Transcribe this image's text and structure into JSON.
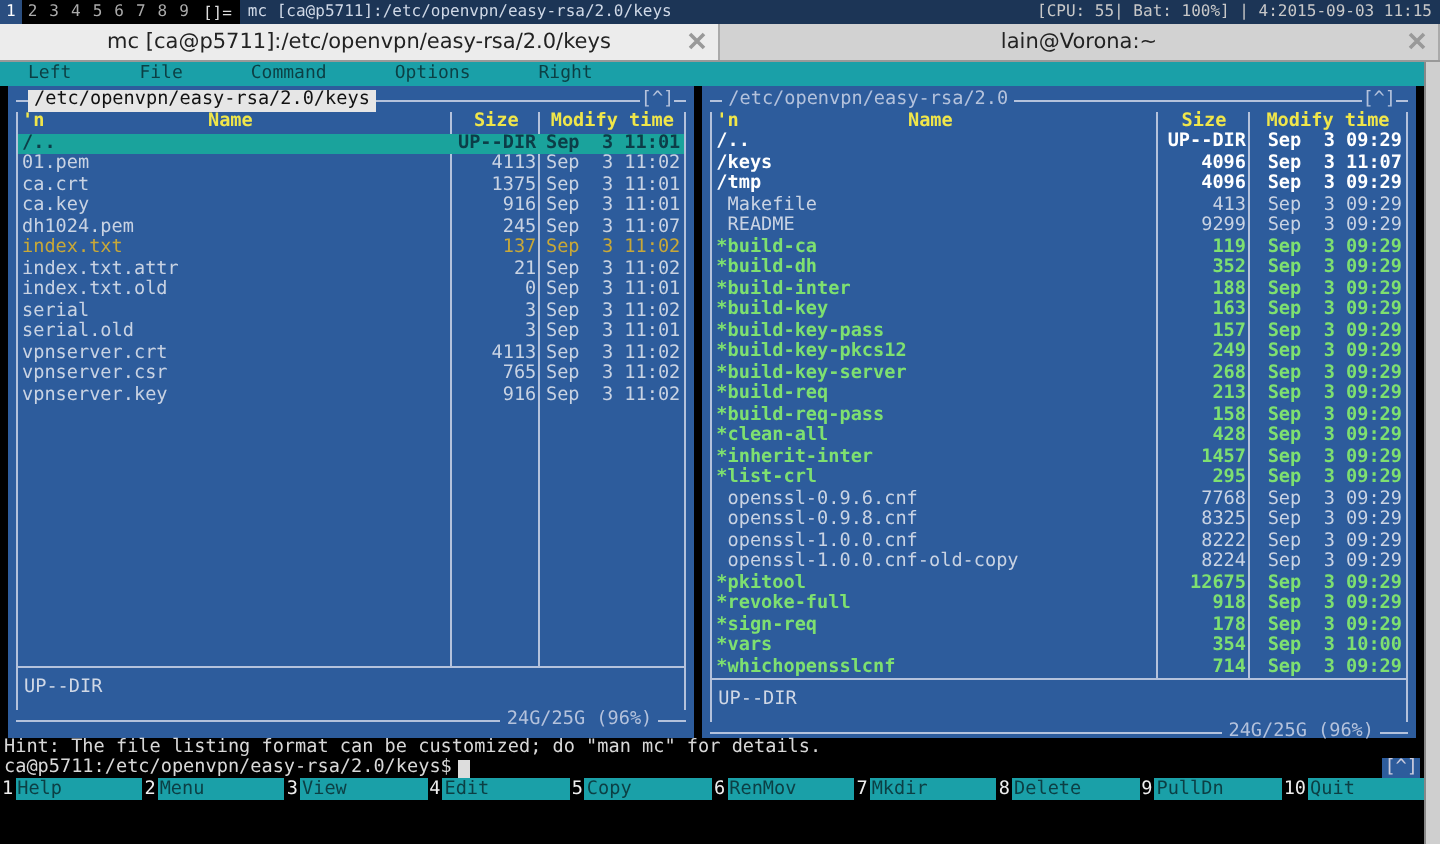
{
  "top_bar": {
    "workspaces": [
      {
        "label": "1",
        "selected": true
      },
      {
        "label": "2",
        "selected": false
      },
      {
        "label": "3",
        "selected": false
      },
      {
        "label": "4",
        "selected": false
      },
      {
        "label": "5",
        "selected": false
      },
      {
        "label": "6",
        "selected": false
      },
      {
        "label": "7",
        "selected": false
      },
      {
        "label": "8",
        "selected": false
      },
      {
        "label": "9",
        "selected": false
      }
    ],
    "layout": "[]=",
    "title": "mc [ca@p5711]:/etc/openvpn/easy-rsa/2.0/keys",
    "status": "[CPU: 55| Bat: 100%] | 4:2015-09-03 11:15"
  },
  "tabs": [
    {
      "title": "mc [ca@p5711]:/etc/openvpn/easy-rsa/2.0/keys",
      "selected": true
    },
    {
      "title": "lain@Vorona:~",
      "selected": false
    }
  ],
  "menu": [
    "Left",
    "File",
    "Command",
    "Options",
    "Right"
  ],
  "panels": [
    {
      "path": "/etc/openvpn/easy-rsa/2.0/keys",
      "active": true,
      "history": "[^]",
      "columns": [
        "'n",
        "Name",
        "Size",
        "Modify time"
      ],
      "rows": [
        {
          "name": "/..",
          "size": "UP--DIR",
          "date": "Sep  3 11:01",
          "kind": "dir",
          "selected": true
        },
        {
          "name": "01.pem",
          "size": "4113",
          "date": "Sep  3 11:02",
          "kind": "file",
          "selected": false
        },
        {
          "name": "ca.crt",
          "size": "1375",
          "date": "Sep  3 11:01",
          "kind": "file",
          "selected": false
        },
        {
          "name": "ca.key",
          "size": "916",
          "date": "Sep  3 11:01",
          "kind": "file",
          "selected": false
        },
        {
          "name": "dh1024.pem",
          "size": "245",
          "date": "Sep  3 11:07",
          "kind": "file",
          "selected": false
        },
        {
          "name": "index.txt",
          "size": "137",
          "date": "Sep  3 11:02",
          "kind": "marked",
          "selected": false
        },
        {
          "name": "index.txt.attr",
          "size": "21",
          "date": "Sep  3 11:02",
          "kind": "file",
          "selected": false
        },
        {
          "name": "index.txt.old",
          "size": "0",
          "date": "Sep  3 11:01",
          "kind": "file",
          "selected": false
        },
        {
          "name": "serial",
          "size": "3",
          "date": "Sep  3 11:02",
          "kind": "file",
          "selected": false
        },
        {
          "name": "serial.old",
          "size": "3",
          "date": "Sep  3 11:01",
          "kind": "file",
          "selected": false
        },
        {
          "name": "vpnserver.crt",
          "size": "4113",
          "date": "Sep  3 11:02",
          "kind": "file",
          "selected": false
        },
        {
          "name": "vpnserver.csr",
          "size": "765",
          "date": "Sep  3 11:02",
          "kind": "file",
          "selected": false
        },
        {
          "name": "vpnserver.key",
          "size": "916",
          "date": "Sep  3 11:02",
          "kind": "file",
          "selected": false
        }
      ],
      "mini_status": "UP--DIR",
      "disk": "24G/25G (96%)"
    },
    {
      "path": "/etc/openvpn/easy-rsa/2.0",
      "active": false,
      "history": "[^]",
      "columns": [
        "'n",
        "Name",
        "Size",
        "Modify time"
      ],
      "rows": [
        {
          "name": "/..",
          "size": "UP--DIR",
          "date": "Sep  3 09:29",
          "kind": "dir",
          "selected": false
        },
        {
          "name": "/keys",
          "size": "4096",
          "date": "Sep  3 11:07",
          "kind": "dir",
          "selected": false
        },
        {
          "name": "/tmp",
          "size": "4096",
          "date": "Sep  3 09:29",
          "kind": "dir",
          "selected": false
        },
        {
          "name": " Makefile",
          "size": "413",
          "date": "Sep  3 09:29",
          "kind": "file",
          "selected": false
        },
        {
          "name": " README",
          "size": "9299",
          "date": "Sep  3 09:29",
          "kind": "file",
          "selected": false
        },
        {
          "name": "*build-ca",
          "size": "119",
          "date": "Sep  3 09:29",
          "kind": "exec",
          "selected": false
        },
        {
          "name": "*build-dh",
          "size": "352",
          "date": "Sep  3 09:29",
          "kind": "exec",
          "selected": false
        },
        {
          "name": "*build-inter",
          "size": "188",
          "date": "Sep  3 09:29",
          "kind": "exec",
          "selected": false
        },
        {
          "name": "*build-key",
          "size": "163",
          "date": "Sep  3 09:29",
          "kind": "exec",
          "selected": false
        },
        {
          "name": "*build-key-pass",
          "size": "157",
          "date": "Sep  3 09:29",
          "kind": "exec",
          "selected": false
        },
        {
          "name": "*build-key-pkcs12",
          "size": "249",
          "date": "Sep  3 09:29",
          "kind": "exec",
          "selected": false
        },
        {
          "name": "*build-key-server",
          "size": "268",
          "date": "Sep  3 09:29",
          "kind": "exec",
          "selected": false
        },
        {
          "name": "*build-req",
          "size": "213",
          "date": "Sep  3 09:29",
          "kind": "exec",
          "selected": false
        },
        {
          "name": "*build-req-pass",
          "size": "158",
          "date": "Sep  3 09:29",
          "kind": "exec",
          "selected": false
        },
        {
          "name": "*clean-all",
          "size": "428",
          "date": "Sep  3 09:29",
          "kind": "exec",
          "selected": false
        },
        {
          "name": "*inherit-inter",
          "size": "1457",
          "date": "Sep  3 09:29",
          "kind": "exec",
          "selected": false
        },
        {
          "name": "*list-crl",
          "size": "295",
          "date": "Sep  3 09:29",
          "kind": "exec",
          "selected": false
        },
        {
          "name": " openssl-0.9.6.cnf",
          "size": "7768",
          "date": "Sep  3 09:29",
          "kind": "file",
          "selected": false
        },
        {
          "name": " openssl-0.9.8.cnf",
          "size": "8325",
          "date": "Sep  3 09:29",
          "kind": "file",
          "selected": false
        },
        {
          "name": " openssl-1.0.0.cnf",
          "size": "8222",
          "date": "Sep  3 09:29",
          "kind": "file",
          "selected": false
        },
        {
          "name": " openssl-1.0.0.cnf-old-copy",
          "size": "8224",
          "date": "Sep  3 09:29",
          "kind": "file",
          "selected": false
        },
        {
          "name": "*pkitool",
          "size": "12675",
          "date": "Sep  3 09:29",
          "kind": "exec",
          "selected": false
        },
        {
          "name": "*revoke-full",
          "size": "918",
          "date": "Sep  3 09:29",
          "kind": "exec",
          "selected": false
        },
        {
          "name": "*sign-req",
          "size": "178",
          "date": "Sep  3 09:29",
          "kind": "exec",
          "selected": false
        },
        {
          "name": "*vars",
          "size": "354",
          "date": "Sep  3 10:00",
          "kind": "exec",
          "selected": false
        },
        {
          "name": "*whichopensslcnf",
          "size": "714",
          "date": "Sep  3 09:29",
          "kind": "exec",
          "selected": false
        }
      ],
      "mini_status": "UP--DIR",
      "disk": "24G/25G (96%)"
    }
  ],
  "hint": "Hint: The file listing format can be customized; do \"man mc\" for details.",
  "prompt": "ca@p5711:/etc/openvpn/easy-rsa/2.0/keys$",
  "prompt_history": "[^]",
  "function_keys": [
    {
      "key": "1",
      "label": "Help"
    },
    {
      "key": "2",
      "label": "Menu"
    },
    {
      "key": "3",
      "label": "View"
    },
    {
      "key": "4",
      "label": "Edit"
    },
    {
      "key": "5",
      "label": "Copy"
    },
    {
      "key": "6",
      "label": "RenMov"
    },
    {
      "key": "7",
      "label": "Mkdir"
    },
    {
      "key": "8",
      "label": "Delete"
    },
    {
      "key": "9",
      "label": "PullDn"
    },
    {
      "key": "10",
      "label": "Quit"
    }
  ]
}
